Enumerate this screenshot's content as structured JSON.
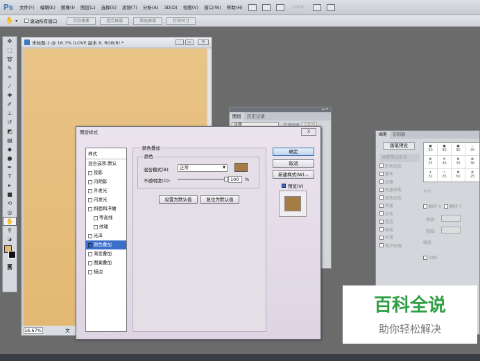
{
  "app": {
    "logo": "Ps"
  },
  "menubar": {
    "items": [
      "文件(F)",
      "编辑(E)",
      "图像(I)",
      "图层(L)",
      "选择(S)",
      "滤镜(T)",
      "分析(A)",
      "3D(D)",
      "视图(V)",
      "窗口(W)",
      "帮助(H)"
    ],
    "zoom": "100%"
  },
  "options_bar": {
    "scroll_all_label": "滚动所有窗口",
    "buttons": [
      "实际像素",
      "适合屏幕",
      "填充屏幕",
      "打印尺寸"
    ]
  },
  "document": {
    "title": "未标题-1 @ 16.7% (LOVE 副本 6, RGB/8) *",
    "zoom": "16.67%",
    "status_label": "文"
  },
  "layers_panel": {
    "tabs": [
      "图层",
      "历史记录"
    ],
    "blend_mode": "正常",
    "opacity_label": "不透明度:",
    "opacity": "100%"
  },
  "brush_panel": {
    "tabs": [
      "画笔",
      "仿制源"
    ],
    "preset_button": "画笔预设",
    "items": [
      "画笔笔尖形状",
      "形状动态",
      "散布",
      "纹理",
      "双重画笔",
      "颜色动态",
      "传递",
      "杂色",
      "湿边",
      "喷枪",
      "平滑",
      "保护纹理"
    ],
    "size_label": "大小",
    "flip_x": "翻转 X",
    "flip_y": "翻转 Y",
    "angle_label": "角度:",
    "roundness_label": "圆度:",
    "hardness_label": "硬度",
    "spacing_label": "间距",
    "brush_sizes": [
      "30",
      "30",
      "30",
      "25",
      "25",
      "36",
      "25",
      "36",
      "32",
      "25",
      "50",
      "25"
    ]
  },
  "dialog": {
    "title": "图层样式",
    "close": "X",
    "styles_header": "样式",
    "styles": [
      {
        "label": "混合选项:默认",
        "checkbox": false
      },
      {
        "label": "投影",
        "checkbox": true,
        "checked": false
      },
      {
        "label": "内阴影",
        "checkbox": true,
        "checked": false
      },
      {
        "label": "外发光",
        "checkbox": true,
        "checked": false
      },
      {
        "label": "内发光",
        "checkbox": true,
        "checked": false
      },
      {
        "label": "斜面和浮雕",
        "checkbox": true,
        "checked": false
      },
      {
        "label": "等高线",
        "checkbox": true,
        "checked": false,
        "indent": true
      },
      {
        "label": "纹理",
        "checkbox": true,
        "checked": false,
        "indent": true
      },
      {
        "label": "光泽",
        "checkbox": true,
        "checked": false
      },
      {
        "label": "颜色叠加",
        "checkbox": true,
        "checked": true,
        "selected": true
      },
      {
        "label": "渐变叠加",
        "checkbox": true,
        "checked": false
      },
      {
        "label": "图案叠加",
        "checkbox": true,
        "checked": false
      },
      {
        "label": "描边",
        "checkbox": true,
        "checked": false
      }
    ],
    "section_title": "颜色叠加",
    "subsection_title": "颜色",
    "blend_mode_label": "混合模式(B):",
    "blend_mode_value": "正常",
    "opacity_label": "不透明度(O):",
    "opacity_value": "100",
    "opacity_unit": "%",
    "opacity_fraction": 1.0,
    "overlay_color": "#a67c45",
    "set_default_button": "设置为默认值",
    "reset_default_button": "复位为默认值",
    "ok_button": "确定",
    "cancel_button": "取消",
    "new_style_button": "新建样式(W)...",
    "preview_label": "预览(V)",
    "preview_checked": true
  },
  "watermark": {
    "title": "百科全说",
    "subtitle": "助你轻松解决"
  },
  "colors": {
    "canvas": "#e6bd7c",
    "accent": "#3b6ec9",
    "watermark_green": "#2f9e44"
  }
}
